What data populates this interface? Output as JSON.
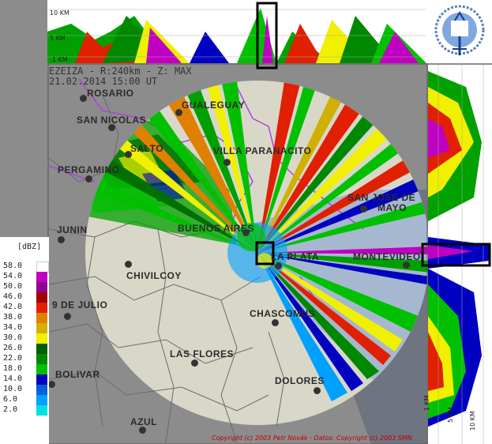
{
  "header": {
    "line1": "EZEIZA - R:240km - Z: MAX",
    "line2": "21.02.2014 15:00 UT"
  },
  "top_panel": {
    "km_labels": [
      "10 KM",
      "5 KM",
      "1 KM"
    ]
  },
  "right_panel": {
    "km_labels": [
      "1 KM",
      "5 KM",
      "10 KM"
    ]
  },
  "cities": [
    {
      "name": "ROSARIO"
    },
    {
      "name": "GUALEGUAY"
    },
    {
      "name": "SAN NICOLAS"
    },
    {
      "name": "SALTO"
    },
    {
      "name": "VILLA PARANACITO"
    },
    {
      "name": "PERGAMINO"
    },
    {
      "name": "SAN JOSE DE"
    },
    {
      "name": "MAYO"
    },
    {
      "name": "JUNIN"
    },
    {
      "name": "BUENOS AIRES"
    },
    {
      "name": "LA PLATA"
    },
    {
      "name": "MONTEVIDEO"
    },
    {
      "name": "CHIVILCOY"
    },
    {
      "name": "9 DE JULIO"
    },
    {
      "name": "CHASCOMUS"
    },
    {
      "name": "LAS FLORES"
    },
    {
      "name": "BOLIVAR"
    },
    {
      "name": "DOLORES"
    },
    {
      "name": "AZUL"
    }
  ],
  "legend": {
    "unit": "[dBZ]",
    "items": [
      {
        "value": "58.0",
        "color": "#ffffff"
      },
      {
        "value": "54.0",
        "color": "#c000c0"
      },
      {
        "value": "50.0",
        "color": "#900090"
      },
      {
        "value": "46.0",
        "color": "#a00000"
      },
      {
        "value": "42.0",
        "color": "#e02000"
      },
      {
        "value": "38.0",
        "color": "#e08000"
      },
      {
        "value": "34.0",
        "color": "#d0b000"
      },
      {
        "value": "30.0",
        "color": "#f0f000"
      },
      {
        "value": "26.0",
        "color": "#006000"
      },
      {
        "value": "22.0",
        "color": "#008800"
      },
      {
        "value": "18.0",
        "color": "#00c000"
      },
      {
        "value": "14.0",
        "color": "#0000c0"
      },
      {
        "value": "10.0",
        "color": "#0060e0"
      },
      {
        "value": "6.0",
        "color": "#00a0ff"
      },
      {
        "value": "2.0",
        "color": "#00e0e0"
      }
    ]
  },
  "copyright": "Copyright (c) 2003 Petr Novák - Datos: Copyright (c) 2003 SMN"
}
